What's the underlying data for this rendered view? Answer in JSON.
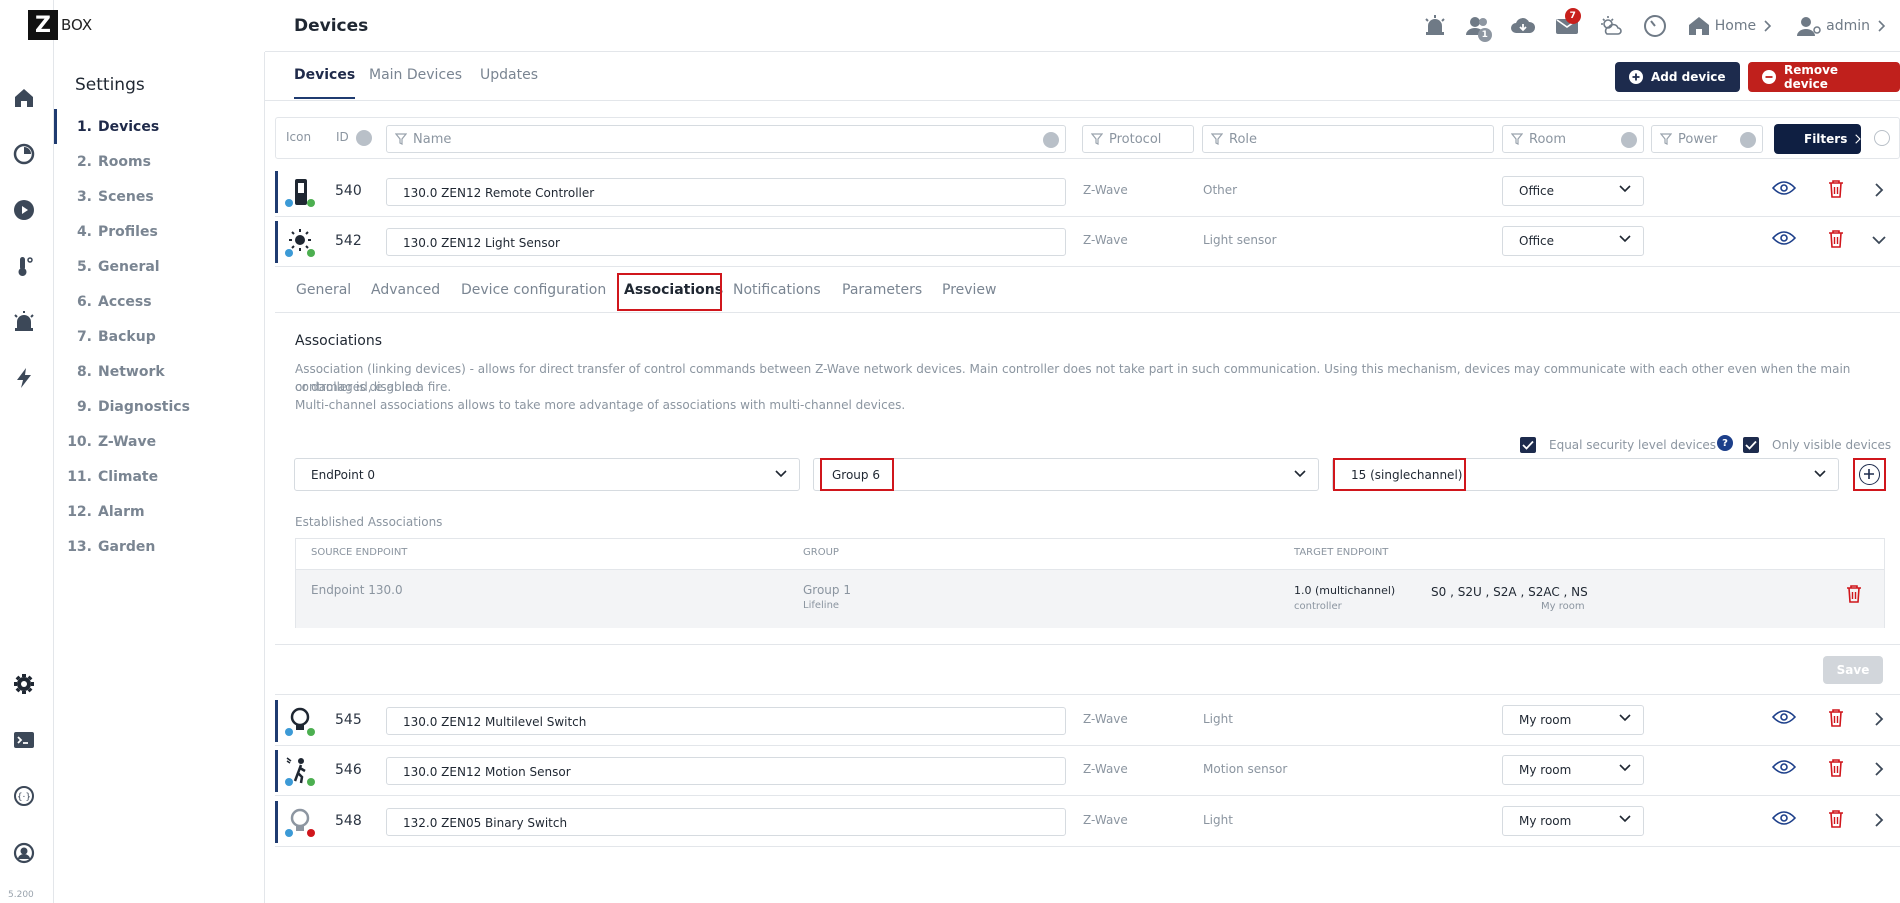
{
  "app": {
    "logo_letter": "Z",
    "logo_text": "BOX",
    "version": "5.200"
  },
  "topbar": {
    "title": "Devices",
    "mail_count": "7",
    "users_count": "1",
    "home_label": "Home",
    "user_label": "admin"
  },
  "sidebar": {
    "title": "Settings",
    "items": [
      {
        "num": "1.",
        "label": "Devices"
      },
      {
        "num": "2.",
        "label": "Rooms"
      },
      {
        "num": "3.",
        "label": "Scenes"
      },
      {
        "num": "4.",
        "label": "Profiles"
      },
      {
        "num": "5.",
        "label": "General"
      },
      {
        "num": "6.",
        "label": "Access"
      },
      {
        "num": "7.",
        "label": "Backup"
      },
      {
        "num": "8.",
        "label": "Network"
      },
      {
        "num": "9.",
        "label": "Diagnostics"
      },
      {
        "num": "10.",
        "label": "Z-Wave"
      },
      {
        "num": "11.",
        "label": "Climate"
      },
      {
        "num": "12.",
        "label": "Alarm"
      },
      {
        "num": "13.",
        "label": "Garden"
      }
    ]
  },
  "tabs": {
    "devices": "Devices",
    "main_devices": "Main Devices",
    "updates": "Updates"
  },
  "actions": {
    "add_device": "Add device",
    "remove_device": "Remove device"
  },
  "filters": {
    "icon_col": "Icon",
    "id_col": "ID",
    "name_ph": "Name",
    "protocol_ph": "Protocol",
    "role_ph": "Role",
    "room_ph": "Room",
    "power_ph": "Power",
    "filters_btn": "Filters"
  },
  "devices": [
    {
      "id": "540",
      "name": "130.0 ZEN12 Remote Controller",
      "protocol": "Z-Wave",
      "role": "Other",
      "room": "Office"
    },
    {
      "id": "542",
      "name": "130.0 ZEN12 Light Sensor",
      "protocol": "Z-Wave",
      "role": "Light sensor",
      "room": "Office"
    },
    {
      "id": "545",
      "name": "130.0 ZEN12 Multilevel Switch",
      "protocol": "Z-Wave",
      "role": "Light",
      "room": "My room"
    },
    {
      "id": "546",
      "name": "130.0 ZEN12 Motion Sensor",
      "protocol": "Z-Wave",
      "role": "Motion sensor",
      "room": "My room"
    },
    {
      "id": "548",
      "name": "132.0 ZEN05 Binary Switch",
      "protocol": "Z-Wave",
      "role": "Light",
      "room": "My room"
    }
  ],
  "detail_tabs": [
    "General",
    "Advanced",
    "Device configuration",
    "Associations",
    "Notifications",
    "Parameters",
    "Preview"
  ],
  "associations": {
    "title": "Associations",
    "desc1": "Association (linking devices) - allows for direct transfer of control commands between Z-Wave network devices. Main controller does not take part in such communication. Using this mechanism, devices may communicate with each other even when the main controller is disabled",
    "desc2": "or damaged, e.g. in a fire.",
    "desc3": "Multi-channel associations allows to take more advantage of associations with multi-channel devices.",
    "equal_security": "Equal security level devices",
    "only_visible": "Only visible devices",
    "endpoint_sel": "EndPoint 0",
    "group_sel": "Group 6",
    "target_sel": "15 (singlechannel)",
    "established": "Established Associations",
    "col_source": "SOURCE ENDPOINT",
    "col_group": "GROUP",
    "col_target": "TARGET ENDPOINT",
    "row": {
      "source": "Endpoint 130.0",
      "group": "Group 1",
      "group_sub": "Lifeline",
      "target": "1.0 (multichannel)",
      "target_sub": "controller",
      "security": "S0 , S2U , S2A , S2AC , NS",
      "security_sub": "My room"
    },
    "save": "Save"
  },
  "colors": {
    "navy": "#1d2b4d",
    "red": "#c0201c",
    "highlight": "#d0161c"
  }
}
